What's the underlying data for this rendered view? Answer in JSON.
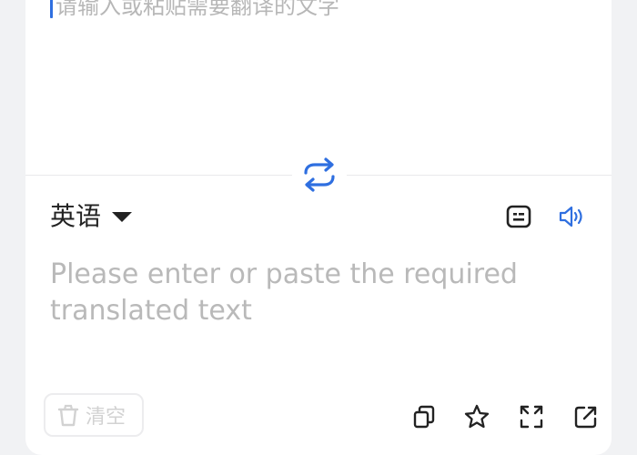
{
  "source": {
    "placeholder": "请输入或粘贴需要翻译的文字"
  },
  "target": {
    "language_label": "英语",
    "placeholder": "Please enter or paste the required translated text"
  },
  "toolbar": {
    "clear_label": "清空"
  },
  "icons": {
    "swap": "swap-languages-icon",
    "dropdown": "dropdown-caret-icon",
    "ocr": "text-recognition-icon",
    "speaker": "speaker-icon",
    "copy": "copy-icon",
    "favorite": "star-icon",
    "fullscreen": "fullscreen-icon",
    "share": "share-icon",
    "clear": "trash-icon"
  },
  "colors": {
    "accent": "#2f6fe0",
    "placeholder": "#b9b9b9",
    "text": "#222222"
  }
}
